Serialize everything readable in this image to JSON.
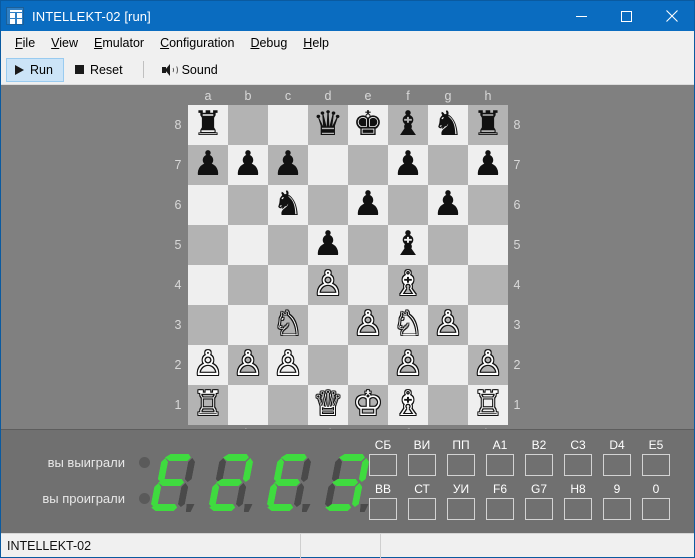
{
  "window": {
    "title": "INTELLEKT-02 [run]",
    "icon": "app-grid-icon",
    "controls": {
      "minimize": "minimize-icon",
      "maximize": "maximize-icon",
      "close": "close-icon"
    },
    "titlebar_color": "#0a6cc0"
  },
  "menubar": {
    "items": [
      {
        "label": "File",
        "mnemonic": "F"
      },
      {
        "label": "View",
        "mnemonic": "V"
      },
      {
        "label": "Emulator",
        "mnemonic": "E"
      },
      {
        "label": "Configuration",
        "mnemonic": "C"
      },
      {
        "label": "Debug",
        "mnemonic": "D"
      },
      {
        "label": "Help",
        "mnemonic": "H"
      }
    ]
  },
  "toolbar": {
    "run_label": "Run",
    "reset_label": "Reset",
    "sound_label": "Sound",
    "active_color": "#cce4f7"
  },
  "board": {
    "files": [
      "a",
      "b",
      "c",
      "d",
      "e",
      "f",
      "g",
      "h"
    ],
    "ranks": [
      "8",
      "7",
      "6",
      "5",
      "4",
      "3",
      "2",
      "1"
    ],
    "light_color": "#efefef",
    "dark_color": "#b3b3b3",
    "surround_color": "#808080",
    "rows": [
      [
        "br",
        "",
        "",
        "bq",
        "bk",
        "bb",
        "bn",
        "br"
      ],
      [
        "bp",
        "bp",
        "bp",
        "",
        "",
        "bp",
        "",
        "bp"
      ],
      [
        "",
        "",
        "bn",
        "",
        "bp",
        "",
        "bp",
        ""
      ],
      [
        "",
        "",
        "",
        "bp",
        "",
        "bb",
        "",
        ""
      ],
      [
        "",
        "",
        "",
        "wp",
        "",
        "wb",
        "",
        ""
      ],
      [
        "",
        "",
        "wn",
        "",
        "wp",
        "wn",
        "wp",
        ""
      ],
      [
        "wp",
        "wp",
        "wp",
        "",
        "",
        "wp",
        "",
        "wp"
      ],
      [
        "wr",
        "",
        "",
        "wq",
        "wk",
        "wb",
        "",
        "wr"
      ]
    ]
  },
  "console": {
    "led_rows": [
      {
        "label": "вы выиграли",
        "lit": false
      },
      {
        "label": "вы проиграли",
        "lit": false
      }
    ],
    "led_off_color": "#5a5a5a",
    "display_value": "E2E3",
    "display_on_color": "#3fdb3f",
    "display_off_color": "#4a4a4a",
    "panel_color": "#707070",
    "keypad": {
      "row1": [
        "СБ",
        "ВИ",
        "ПП",
        "A1",
        "B2",
        "C3",
        "D4",
        "E5"
      ],
      "row2": [
        "ВВ",
        "СТ",
        "УИ",
        "F6",
        "G7",
        "H8",
        "9",
        "0"
      ]
    }
  },
  "statusbar": {
    "cells": [
      "INTELLEKT-02",
      "",
      ""
    ]
  }
}
